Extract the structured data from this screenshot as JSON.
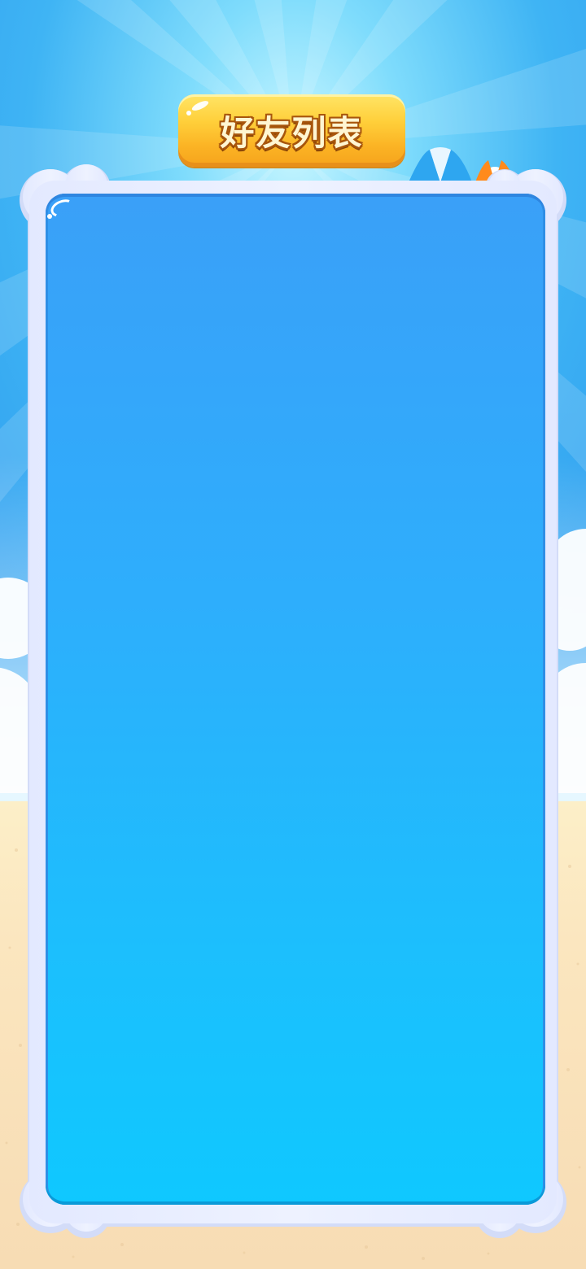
{
  "screen": {
    "name": "friends-list-screen"
  },
  "header": {
    "title": "好友列表"
  },
  "panel": {
    "items": []
  },
  "decorations": {
    "umbrella_colors": [
      "#2fa6f2",
      "#ff8a1c"
    ],
    "background_icons": [
      "sky-rays",
      "cloud",
      "beach-sand",
      "beach-umbrella-icon"
    ]
  },
  "colors": {
    "sky_top": "#36a7f2",
    "sky_glow": "#b8f2ff",
    "sand": "#fbe6bf",
    "frame": "#e6ecff",
    "panel_top": "#3aa0f8",
    "panel_bottom": "#0fc8ff",
    "title_badge": "#ffcf3a",
    "title_text": "#fff6d2"
  }
}
